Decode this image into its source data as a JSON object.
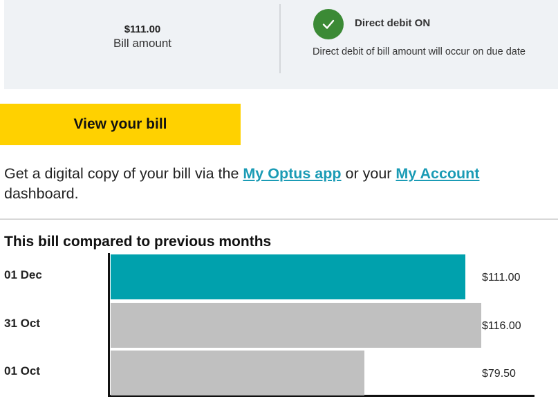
{
  "summary": {
    "bill_value": "$111.00",
    "bill_label": "Bill amount",
    "direct_debit_title": "Direct debit ON",
    "direct_debit_desc": "Direct debit of bill amount will occur on due date",
    "status_color": "#3b8a35",
    "icon": "checkmark-icon"
  },
  "view_bill": {
    "label": "View your bill",
    "color": "#ffd100"
  },
  "info": {
    "prefix": "Get a digital copy of your bill via the ",
    "link1": "My Optus app",
    "middle": " or your ",
    "link2": "My Account",
    "suffix": " dashboard.",
    "link_color": "#1a9bb5"
  },
  "comparison_title": "This bill compared to previous months",
  "chart_data": {
    "type": "bar",
    "orientation": "horizontal",
    "categories": [
      "01 Dec",
      "31 Oct",
      "01 Oct"
    ],
    "values": [
      111.0,
      116.0,
      79.5
    ],
    "value_labels": [
      "$111.00",
      "$116.00",
      "$79.50"
    ],
    "colors": [
      "#00a1ad",
      "#c0c0c0",
      "#c0c0c0"
    ],
    "xlim": [
      0,
      116.0
    ]
  }
}
